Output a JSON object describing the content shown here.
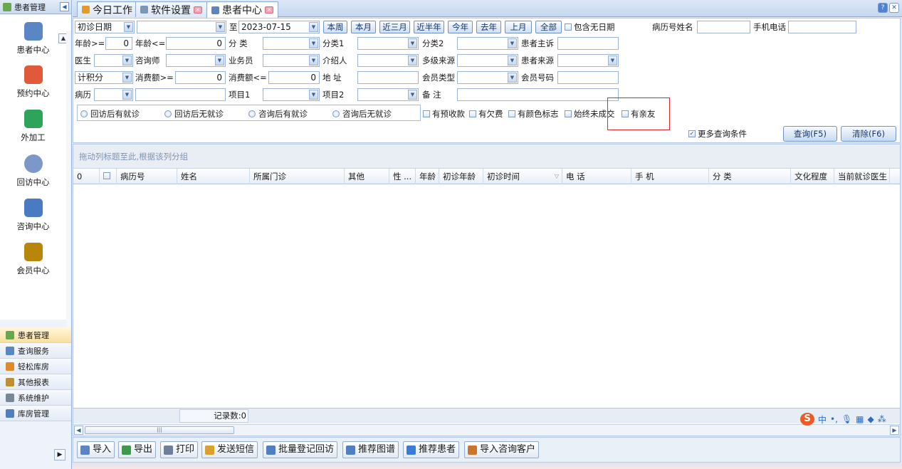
{
  "left_panel": {
    "header_title": "患者管理",
    "nav_items": [
      {
        "label": "患者中心",
        "icon": "binoculars-icon",
        "color": "#5a86c5"
      },
      {
        "label": "预约中心",
        "icon": "calendar-icon",
        "color": "#e05a3a"
      },
      {
        "label": "外加工",
        "icon": "cubes-icon",
        "color": "#2fa35a"
      },
      {
        "label": "回访中心",
        "icon": "refresh-icon",
        "color": "#7b98c8"
      },
      {
        "label": "咨询中心",
        "icon": "consultant-icon",
        "color": "#4a7bc2"
      },
      {
        "label": "会员中心",
        "icon": "members-icon",
        "color": "#b8860b"
      }
    ],
    "bottom_items": [
      {
        "label": "患者管理",
        "icon": "patients-icon",
        "color": "#6aa84f"
      },
      {
        "label": "查询服务",
        "icon": "search-icon",
        "color": "#5b86c4"
      },
      {
        "label": "轻松库房",
        "icon": "warehouse-icon",
        "color": "#e08a2a"
      },
      {
        "label": "其他报表",
        "icon": "report-icon",
        "color": "#c0902c"
      },
      {
        "label": "系统维护",
        "icon": "tools-icon",
        "color": "#7a8797"
      },
      {
        "label": "库房管理",
        "icon": "store-icon",
        "color": "#4f7fbf"
      }
    ]
  },
  "tabs": [
    {
      "label": "今日工作",
      "icon": "today-icon",
      "color": "#e29a2a"
    },
    {
      "label": "软件设置",
      "icon": "settings-icon",
      "color": "#7c96ba"
    },
    {
      "label": "患者中心",
      "icon": "binoculars-icon",
      "color": "#5a86c5"
    }
  ],
  "filters": {
    "date_type": "初诊日期",
    "date_from": "",
    "to_label": "至",
    "date_to": "2023-07-15",
    "period_buttons": [
      "本周",
      "本月",
      "近三月",
      "近半年",
      "今年",
      "去年",
      "上月",
      "全部"
    ],
    "include_no_date": "包含无日期",
    "record_no_name_label": "病历号姓名",
    "mobile_label": "手机电话",
    "age_ge_label": "年龄>=",
    "age_ge_value": "0",
    "age_le_label": "年龄<=",
    "age_le_value": "0",
    "category_label": "分  类",
    "category1_label": "分类1",
    "category2_label": "分类2",
    "complaint_label": "患者主诉",
    "doctor_label": "医生",
    "consultant_label": "咨询师",
    "salesman_label": "业务员",
    "referrer_label": "介绍人",
    "multi_source_label": "多级来源",
    "patient_source_label": "患者来源",
    "points_label": "计积分",
    "spend_ge_label": "消费额>=",
    "spend_ge_value": "0",
    "spend_le_label": "消费额<=",
    "spend_le_value": "0",
    "address_label": "地  址",
    "member_type_label": "会员类型",
    "member_no_label": "会员号码",
    "history_label": "病历",
    "item1_label": "项目1",
    "item2_label": "项目2",
    "remark_label": "备  注",
    "radios": [
      "回访后有就诊",
      "回访后无就诊",
      "咨询后有就诊",
      "咨询后无就诊"
    ],
    "checkboxes": [
      "有预收款",
      "有欠费",
      "有颜色标志",
      "始终未成交",
      "有亲友"
    ],
    "more_conditions": "更多查询条件",
    "query_button": "查询(F5)",
    "clear_button": "清除(F6)"
  },
  "grid": {
    "group_hint": "拖动列标题至此,根据该列分组",
    "columns": [
      "0",
      "",
      "病历号",
      "姓名",
      "所属门诊",
      "其他",
      "性 ...",
      "年龄",
      "初诊年龄",
      "初诊时间",
      "电  话",
      "手  机",
      "分  类",
      "文化程度",
      "当前就诊医生"
    ],
    "record_count": "记录数:0"
  },
  "toolbar": {
    "buttons": [
      {
        "label": "导入",
        "icon": "import-icon",
        "color": "#5b86c4"
      },
      {
        "label": "导出",
        "icon": "export-icon",
        "color": "#3c9a4a"
      },
      {
        "label": "打印",
        "icon": "print-icon",
        "color": "#6d7f99"
      },
      {
        "label": "发送短信",
        "icon": "sms-icon",
        "color": "#d9a12b"
      },
      {
        "label": "批量登记回访",
        "icon": "batch-visit-icon",
        "color": "#4f7fbf"
      },
      {
        "label": "推荐图谱",
        "icon": "graph-icon",
        "color": "#4f7fbf"
      },
      {
        "label": "推荐患者",
        "icon": "recommend-icon",
        "color": "#3a7bd5"
      },
      {
        "label": "导入咨询客户",
        "icon": "import-consult-icon",
        "color": "#c9762c"
      }
    ]
  },
  "ime": {
    "logo": "S",
    "lang": "中"
  }
}
